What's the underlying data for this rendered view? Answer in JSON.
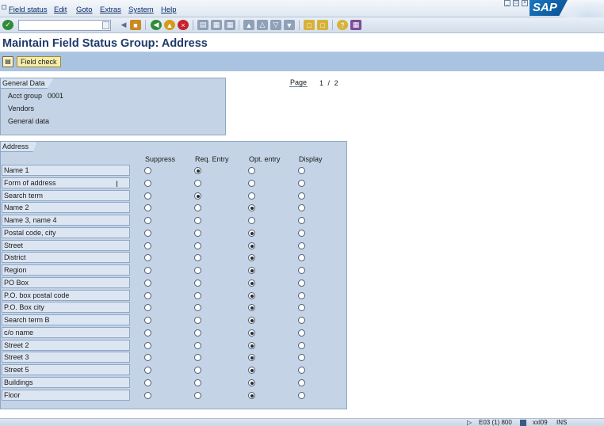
{
  "menubar": {
    "items": [
      "Field status",
      "Edit",
      "Goto",
      "Extras",
      "System",
      "Help"
    ]
  },
  "brand": {
    "logo_text": "SAP",
    "accent": "#1a78c2"
  },
  "toolbar": {
    "command_field": {
      "value": "",
      "placeholder": ""
    },
    "icons": [
      "enter-icon",
      "save-icon",
      "back-icon",
      "exit-icon",
      "cancel-icon",
      "print-icon",
      "find-icon",
      "find-next-icon",
      "first-page-icon",
      "previous-page-icon",
      "next-page-icon",
      "last-page-icon",
      "create-session-icon",
      "shortcut-icon",
      "help-icon",
      "layout-icon"
    ]
  },
  "page": {
    "title": "Maintain Field Status Group: Address"
  },
  "app_toolbar": {
    "field_check_label": "Field check"
  },
  "general_data": {
    "tab_label": "General Data",
    "acct_group_label": "Acct group",
    "acct_group_value": "0001",
    "line2": "Vendors",
    "line3": "General data"
  },
  "pager": {
    "label": "Page",
    "current": "1",
    "separator": "/",
    "total": "2"
  },
  "address": {
    "tab_label": "Address",
    "columns": [
      "Suppress",
      "Req. Entry",
      "Opt. entry",
      "Display"
    ],
    "rows": [
      {
        "label": "Name 1",
        "selected": 1
      },
      {
        "label": "Form of address",
        "selected": -1
      },
      {
        "label": "Search term",
        "selected": 1
      },
      {
        "label": "Name 2",
        "selected": 2
      },
      {
        "label": "Name 3, name 4",
        "selected": -1
      },
      {
        "label": "Postal code, city",
        "selected": 2
      },
      {
        "label": "Street",
        "selected": 2
      },
      {
        "label": "District",
        "selected": 2
      },
      {
        "label": "Region",
        "selected": 2
      },
      {
        "label": "PO Box",
        "selected": 2
      },
      {
        "label": "P.O. box postal code",
        "selected": 2
      },
      {
        "label": "P.O. Box city",
        "selected": 2
      },
      {
        "label": "Search term B",
        "selected": 2
      },
      {
        "label": "c/o name",
        "selected": 2
      },
      {
        "label": "Street 2",
        "selected": 2
      },
      {
        "label": "Street 3",
        "selected": 2
      },
      {
        "label": "Street 5",
        "selected": 2
      },
      {
        "label": "Buildings",
        "selected": 2
      },
      {
        "label": "Floor",
        "selected": 2
      }
    ]
  },
  "statusbar": {
    "system": "E03 (1) 800",
    "server": "xxl09",
    "mode": "INS"
  }
}
